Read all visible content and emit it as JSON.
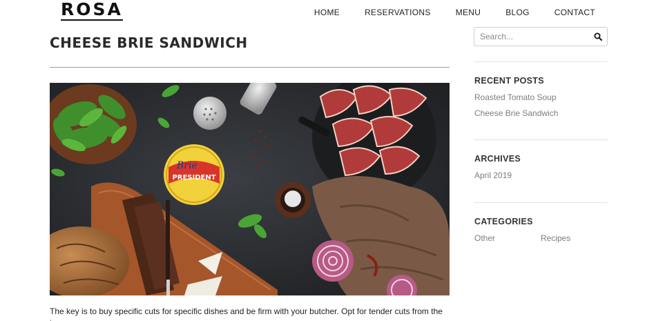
{
  "header": {
    "logo": "ROSA",
    "nav": [
      {
        "label": "HOME"
      },
      {
        "label": "RESERVATIONS"
      },
      {
        "label": "MENU"
      },
      {
        "label": "BLOG"
      },
      {
        "label": "CONTACT"
      }
    ]
  },
  "post": {
    "title": "CHEESE BRIE SANDWICH",
    "image": {
      "cheese_label": "PRESIDENT",
      "cheese_script": "Brie"
    },
    "body_text": "The key is to buy specific cuts for specific dishes and be firm with your butcher. Opt for tender cuts from the inner"
  },
  "sidebar": {
    "search": {
      "placeholder": "Search...",
      "icon": "search-icon"
    },
    "recent_posts": {
      "heading": "RECENT POSTS",
      "items": [
        "Roasted Tomato Soup",
        "Cheese Brie Sandwich"
      ]
    },
    "archives": {
      "heading": "ARCHIVES",
      "items": [
        "April 2019"
      ]
    },
    "categories": {
      "heading": "CATEGORIES",
      "items": [
        "Other",
        "Recipes"
      ]
    }
  }
}
